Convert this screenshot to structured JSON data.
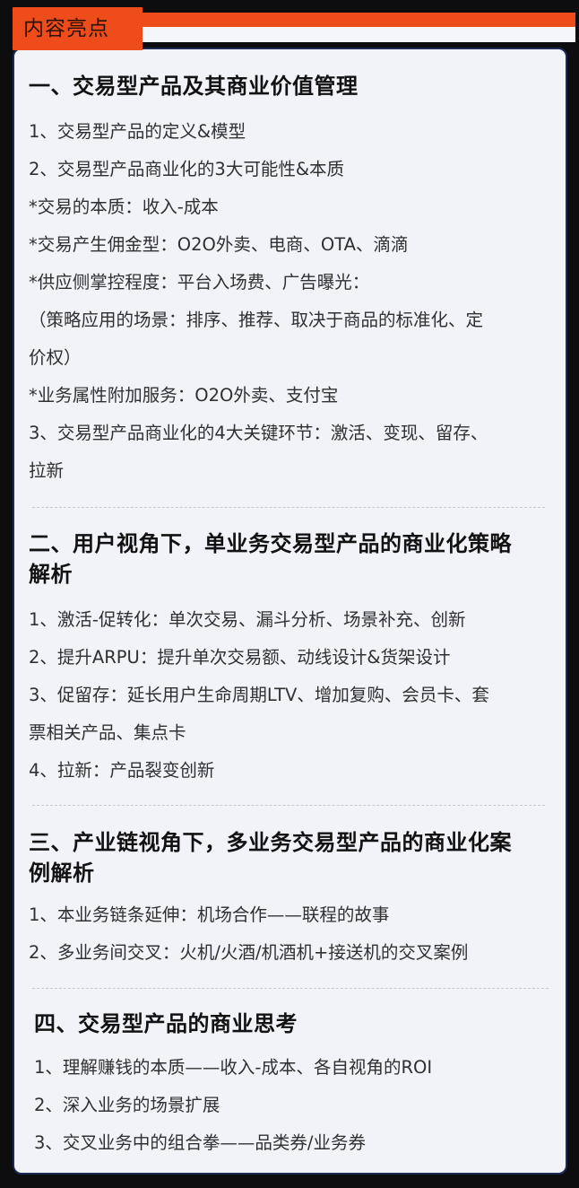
{
  "header": {
    "tab_label": "内容亮点"
  },
  "sections": [
    {
      "heading": "一、交易型产品及其商业价值管理",
      "items": [
        "1、交易型产品的定义&模型",
        "2、交易型产品商业化的3大可能性&本质",
        "*交易的本质：收入-成本",
        "*交易产生佣金型：O2O外卖、电商、OTA、滴滴",
        "*供应侧掌控程度：平台入场费、广告曝光：",
        "（策略应用的场景：排序、推荐、取决于商品的标准化、定",
        "价权）",
        "*业务属性附加服务：O2O外卖、支付宝",
        "3、交易型产品商业化的4大关键环节：激活、变现、留存、",
        "拉新"
      ]
    },
    {
      "heading": [
        "二、用户视角下，单业务交易型产品的商业化策略",
        "解析"
      ],
      "items": [
        "1、激活-促转化：单次交易、漏斗分析、场景补充、创新",
        "2、提升ARPU：提升单次交易额、动线设计&货架设计",
        "3、促留存：延长用户生命周期LTV、增加复购、会员卡、套",
        "票相关产品、集点卡",
        "4、拉新：产品裂变创新"
      ]
    },
    {
      "heading": [
        "三、产业链视角下，多业务交易型产品的商业化案",
        "例解析"
      ],
      "items": [
        "1、本业务链条延伸：机场合作——联程的故事",
        "2、多业务间交叉：火机/火酒/机酒机+接送机的交叉案例"
      ]
    },
    {
      "heading": "四、交易型产品的商业思考",
      "items": [
        "1、理解赚钱的本质——收入-成本、各自视角的ROI",
        "2、深入业务的场景扩展",
        "3、交叉业务中的组合拳——品类券/业务券"
      ]
    }
  ]
}
